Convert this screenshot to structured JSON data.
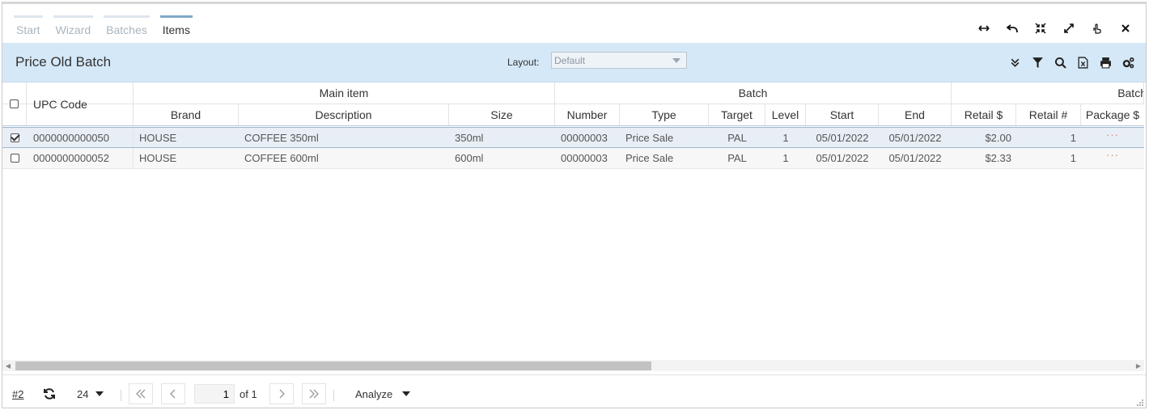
{
  "tabs": [
    {
      "label": "Start",
      "active": false
    },
    {
      "label": "Wizard",
      "active": false
    },
    {
      "label": "Batches",
      "active": false
    },
    {
      "label": "Items",
      "active": true
    }
  ],
  "window_tools": [
    "horizontal-resize-icon",
    "undo-icon",
    "shrink-icon",
    "expand-icon",
    "pointer-icon",
    "close-icon"
  ],
  "toolbar": {
    "title": "Price Old Batch",
    "layout_label": "Layout:",
    "layout_value": "Default",
    "tools": [
      "collapse-icon",
      "filter-icon",
      "search-icon",
      "excel-export-icon",
      "print-icon",
      "settings-icon"
    ]
  },
  "grid": {
    "group_headers": [
      "Main item",
      "Batch",
      "Batch"
    ],
    "upc_header": "UPC Code",
    "columns": [
      "Brand",
      "Description",
      "Size",
      "Number",
      "Type",
      "Target",
      "Level",
      "Start",
      "End",
      "Retail $",
      "Retail #",
      "Package $"
    ],
    "rows": [
      {
        "selected": true,
        "upc": "0000000000050",
        "brand": "HOUSE",
        "description": "COFFEE 350ml",
        "size": "350ml",
        "number": "00000003",
        "type": "Price Sale",
        "target": "PAL",
        "level": "1",
        "start": "05/01/2022",
        "end": "05/01/2022",
        "retail": "$2.00",
        "retail_qty": "1",
        "package": "···"
      },
      {
        "selected": false,
        "upc": "0000000000052",
        "brand": "HOUSE",
        "description": "COFFEE 600ml",
        "size": "600ml",
        "number": "00000003",
        "type": "Price Sale",
        "target": "PAL",
        "level": "1",
        "start": "05/01/2022",
        "end": "05/01/2022",
        "retail": "$2.33",
        "retail_qty": "1",
        "package": "···"
      }
    ]
  },
  "pager": {
    "ref_link": "#2",
    "page_size": "24",
    "current_page": "1",
    "of_label": "of 1",
    "analyze_label": "Analyze"
  }
}
